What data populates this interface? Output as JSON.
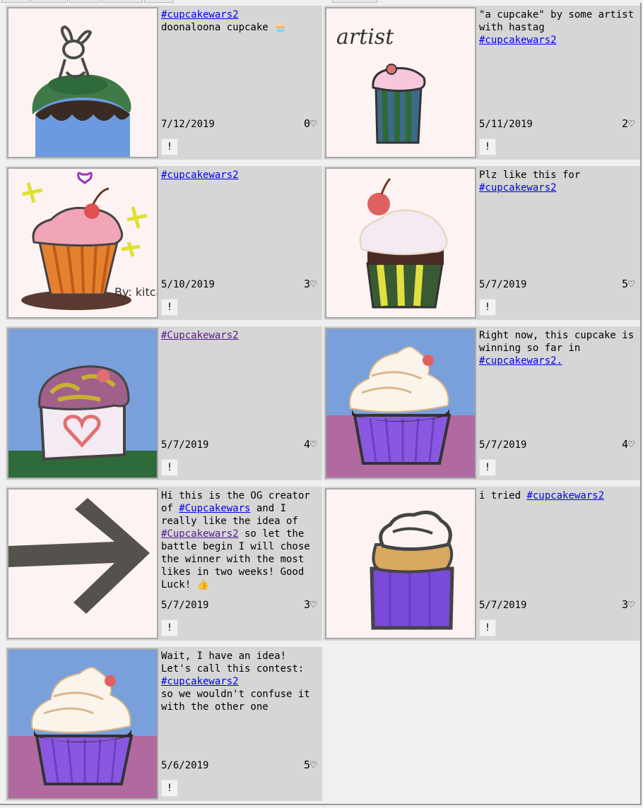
{
  "posts": [
    {
      "pre": "",
      "tag": "#cupcakewars2",
      "tag_visited": false,
      "post": "\ndoonaloona cupcake 🧁",
      "date": "7/12/2019",
      "likes": "0♡",
      "report": "!"
    },
    {
      "pre": "\"a cupcake\" by some artist with hastag\n",
      "tag": "#cupcakewars2",
      "tag_visited": false,
      "post": "",
      "date": "5/11/2019",
      "likes": "2♡",
      "report": "!",
      "art_text": "artist"
    },
    {
      "pre": "",
      "tag": "#cupcakewars2",
      "tag_visited": false,
      "post": "",
      "date": "5/10/2019",
      "likes": "3♡",
      "report": "!",
      "art_text": "By: kitcat"
    },
    {
      "pre": "Plz like this for\n",
      "tag": "#cupcakewars2",
      "tag_visited": false,
      "post": "",
      "date": "5/7/2019",
      "likes": "5♡",
      "report": "!"
    },
    {
      "pre": "",
      "tag": "#Cupcakewars2",
      "tag_visited": true,
      "post": "",
      "date": "5/7/2019",
      "likes": "4♡",
      "report": "!"
    },
    {
      "pre": "Right now, this cupcake is winning so far in\n",
      "tag": "#cupcakewars2.",
      "tag_visited": false,
      "post": "",
      "date": "5/7/2019",
      "likes": "4♡",
      "report": "!"
    },
    {
      "pre": "Hi this is the OG creator of ",
      "tag": "#Cupcakewars",
      "tag_visited": false,
      "mid": " and I really like the idea of\n",
      "tag2": "#Cupcakewars2",
      "post": " so let the battle begin I will chose the winner with the most likes in two weeks! Good Luck! 👍",
      "date": "5/7/2019",
      "likes": "3♡",
      "report": "!"
    },
    {
      "pre": "i tried ",
      "tag": "#cupcakewars2",
      "tag_visited": false,
      "post": "",
      "date": "5/7/2019",
      "likes": "3♡",
      "report": "!"
    },
    {
      "pre": "Wait, I have an idea! Let's call this contest: ",
      "tag": "#cupcakewars2",
      "tag_visited": false,
      "post": "\nso we wouldn't confuse it with the other one",
      "date": "5/6/2019",
      "likes": "5♡",
      "report": "!"
    }
  ]
}
